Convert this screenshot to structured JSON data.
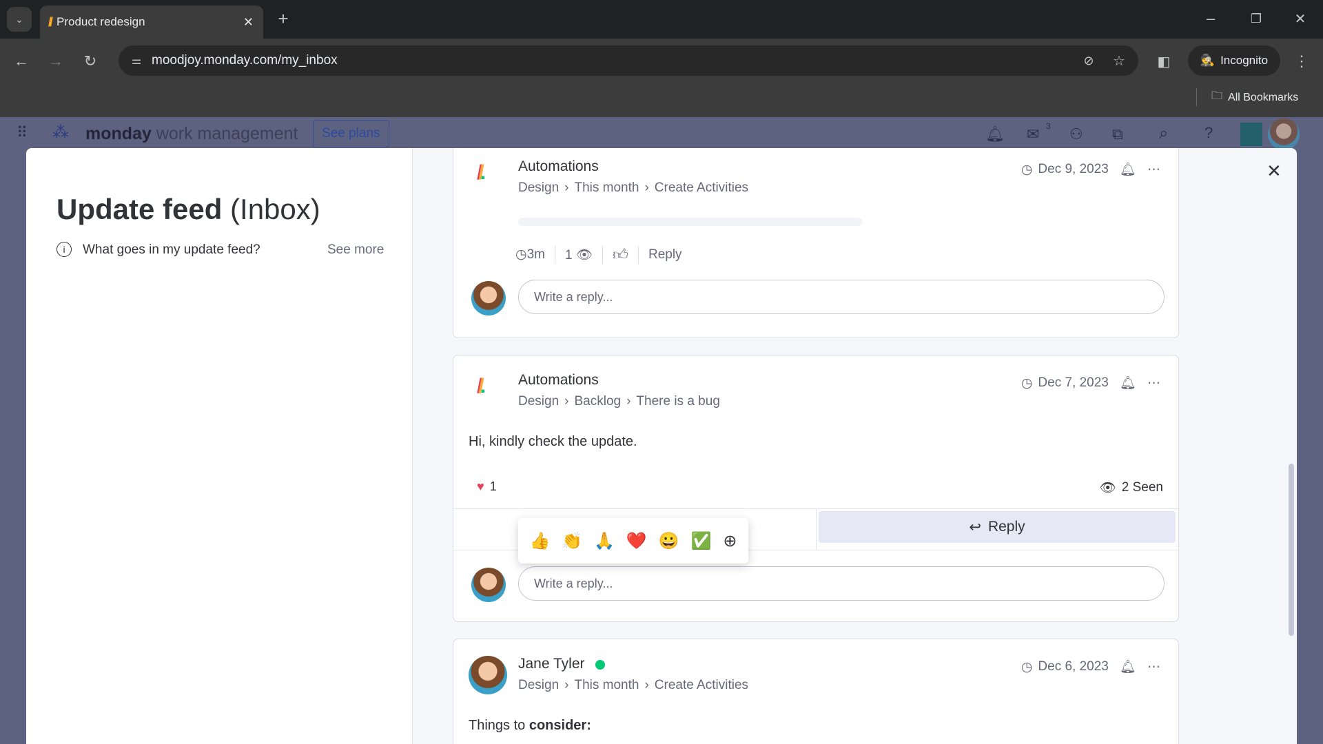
{
  "browser": {
    "tab_title": "Product redesign",
    "url": "moodjoy.monday.com/my_inbox",
    "incognito": "Incognito",
    "bookmarks": "All Bookmarks"
  },
  "app": {
    "brand": "monday",
    "brand_sub": "work management",
    "see_plans": "See plans",
    "inbox_badge": "3"
  },
  "left": {
    "title": "Update feed",
    "title_suffix": "(Inbox)",
    "help": "What goes in my update feed?",
    "see_more": "See more"
  },
  "cards": [
    {
      "author": "Automations",
      "crumbs": [
        "Design",
        "This month",
        "Create Activities"
      ],
      "date": "Dec 9, 2023",
      "time": "3m",
      "views": "1",
      "reply": "Reply",
      "reply_placeholder": "Write a reply..."
    },
    {
      "author": "Automations",
      "crumbs": [
        "Design",
        "Backlog",
        "There is a bug"
      ],
      "date": "Dec 7, 2023",
      "body": "Hi, kindly check the update.",
      "reaction_count": "1",
      "seen": "2 Seen",
      "reply": "Reply",
      "reply_placeholder": "Write a reply...",
      "emojis": [
        "👍",
        "👏",
        "🙏",
        "❤️",
        "😀",
        "✅",
        "⊕"
      ]
    },
    {
      "author": "Jane Tyler",
      "crumbs": [
        "Design",
        "This month",
        "Create Activities"
      ],
      "date": "Dec 6, 2023",
      "body_prefix": "Things to ",
      "body_bold": "consider:",
      "online_color": "#00c875"
    }
  ],
  "colors": {
    "accent": "#0073ea",
    "reply_bg": "#e6e9f5"
  }
}
